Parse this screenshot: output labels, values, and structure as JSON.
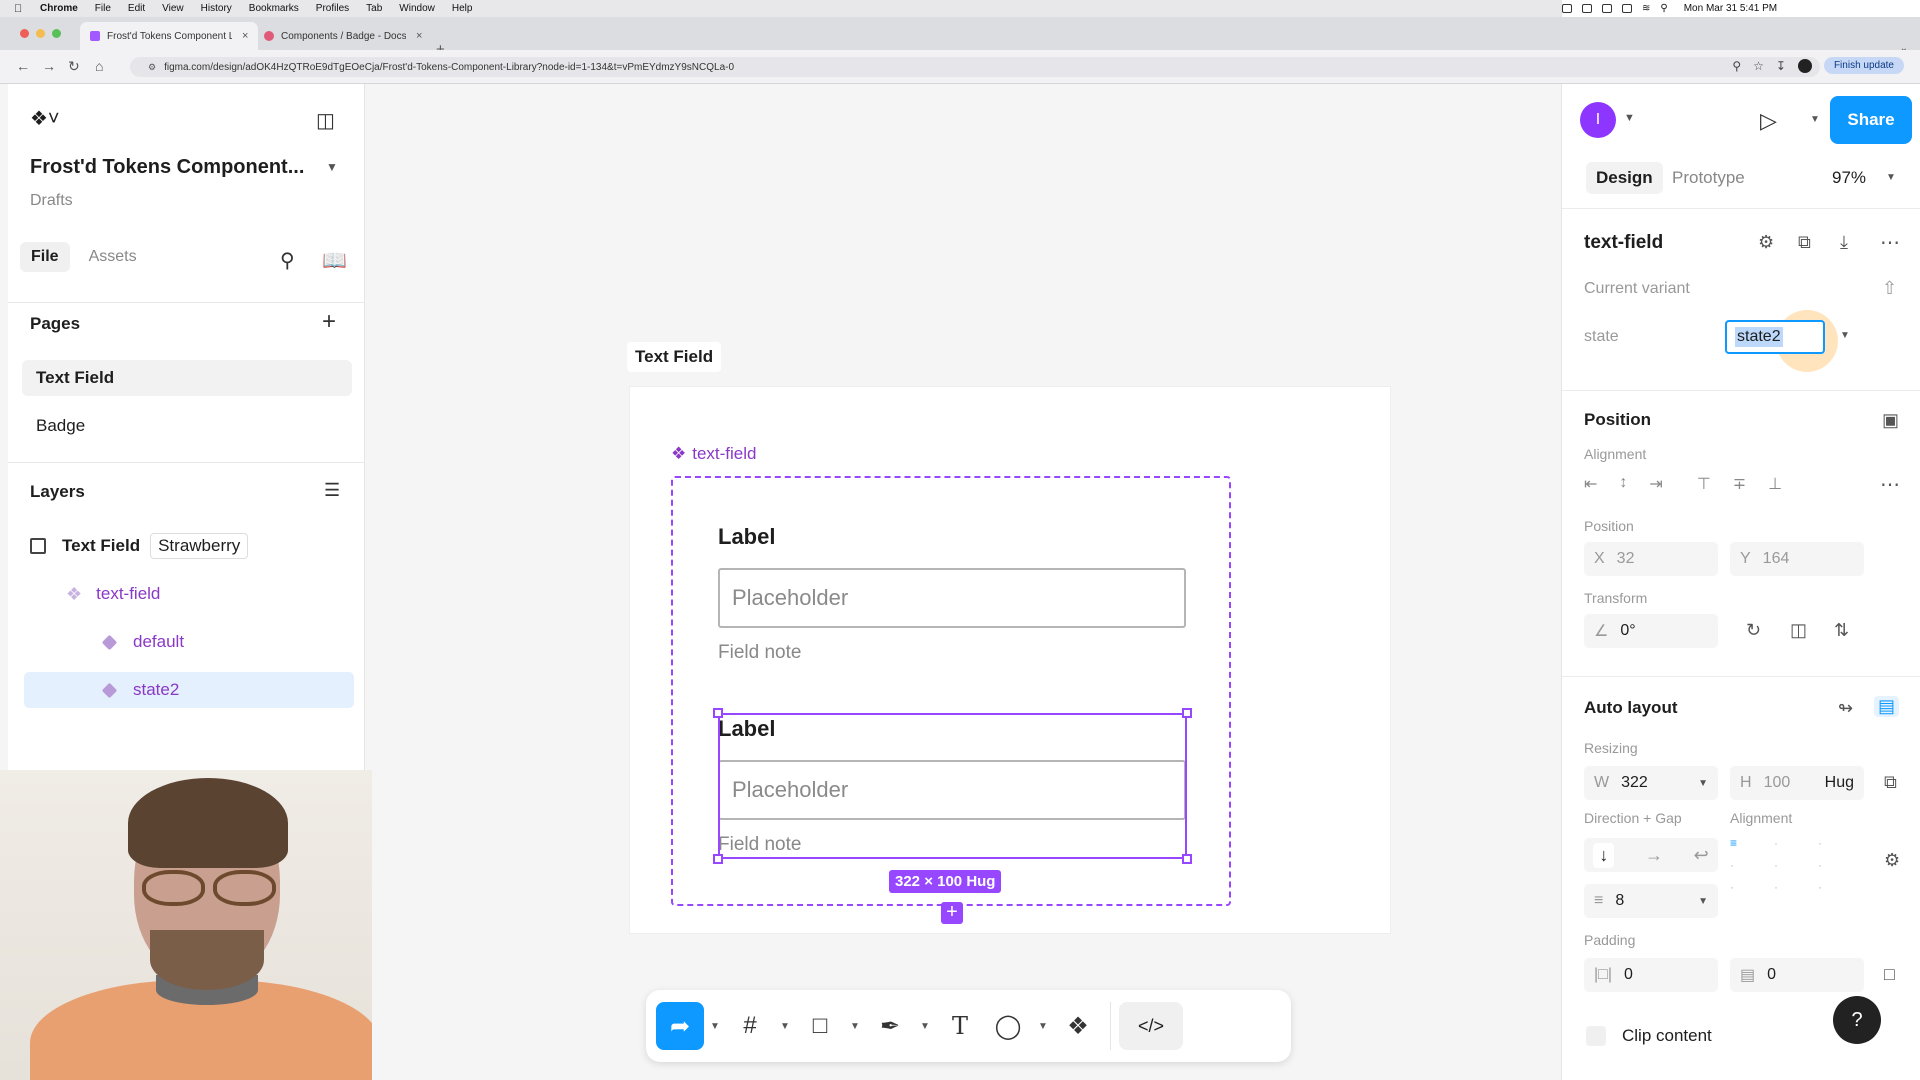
{
  "menubar": {
    "items": [
      "Chrome",
      "File",
      "Edit",
      "View",
      "History",
      "Bookmarks",
      "Profiles",
      "Tab",
      "Window",
      "Help"
    ],
    "clock": "Mon Mar 31  5:41 PM"
  },
  "browser": {
    "tabs": [
      {
        "title": "Frost'd Tokens Component L",
        "close": "×"
      },
      {
        "title": "Components / Badge - Docs",
        "close": "×"
      }
    ],
    "new_tab": "+",
    "url": "figma.com/design/adOK4HzQTRoE9dTgEOeCja/Frost'd-Tokens-Component-Library?node-id=1-134&t=vPmEYdmzY9sNCQLa-0",
    "finish_update": "Finish update"
  },
  "left_panel": {
    "file_title": "Frost'd Tokens Component...",
    "subtitle": "Drafts",
    "tabs": [
      "File",
      "Assets"
    ],
    "pages_heading": "Pages",
    "pages": [
      "Text Field",
      "Badge"
    ],
    "layers_heading": "Layers",
    "layers": {
      "root": "Text Field",
      "root_tag": "Strawberry",
      "component_set": "text-field",
      "variants": [
        "default",
        "state2"
      ]
    }
  },
  "canvas": {
    "frame_label": "Text Field",
    "component_label": "text-field",
    "variant_default": {
      "label": "Label",
      "placeholder": "Placeholder",
      "note": "Field note"
    },
    "variant_state2": {
      "label": "Label",
      "placeholder": "Placeholder",
      "note": "Field note"
    },
    "size_badge": "322 × 100 Hug"
  },
  "right_panel": {
    "avatar_initial": "I",
    "share": "Share",
    "tabs": [
      "Design",
      "Prototype"
    ],
    "zoom": "97%",
    "layer_name": "text-field",
    "current_variant": "Current variant",
    "state_label": "state",
    "state_value": "state2",
    "position_heading": "Position",
    "alignment_label": "Alignment",
    "position_label": "Position",
    "x_label": "X",
    "x_value": "32",
    "y_label": "Y",
    "y_value": "164",
    "transform_label": "Transform",
    "rotation": "0°",
    "autolayout_heading": "Auto layout",
    "resizing_label": "Resizing",
    "w_label": "W",
    "w_value": "322",
    "h_label": "H",
    "h_value": "100",
    "h_mode": "Hug",
    "direction_gap_label": "Direction + Gap",
    "alignment2_label": "Alignment",
    "gap_value": "8",
    "padding_label": "Padding",
    "padding_h": "0",
    "padding_v": "0",
    "clip_content": "Clip content",
    "help": "?"
  },
  "colors": {
    "accent": "#0d99ff",
    "component": "#9747ff",
    "component_text": "#8a38c8",
    "avatar": "#8d36ff"
  }
}
